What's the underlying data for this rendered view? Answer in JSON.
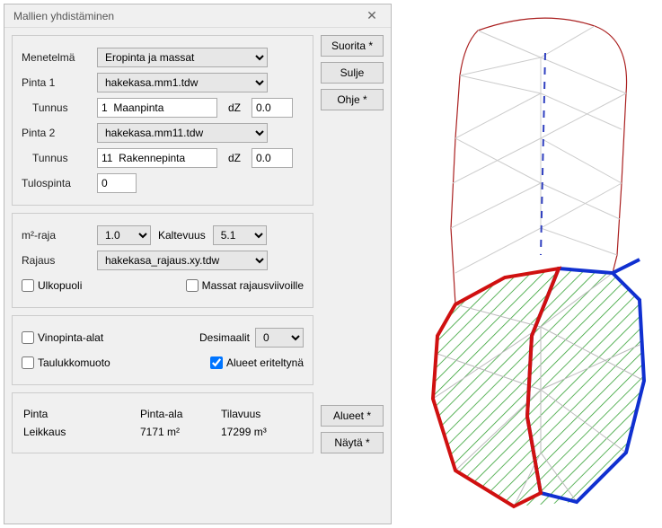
{
  "title": "Mallien yhdistäminen",
  "buttons": {
    "suorita": "Suorita *",
    "sulje": "Sulje",
    "ohje": "Ohje *",
    "alueet": "Alueet *",
    "nayta": "Näytä *"
  },
  "labels": {
    "menetelma": "Menetelmä",
    "pinta1": "Pinta 1",
    "pinta2": "Pinta 2",
    "tunnus": "Tunnus",
    "dz": "dZ",
    "tulospinta": "Tulospinta",
    "m2raja": "m²-raja",
    "kaltevuus": "Kaltevuus",
    "rajaus": "Rajaus",
    "ulkopuoli": "Ulkopuoli",
    "massat_rajaus": "Massat rajausviivoille",
    "vinopinta": "Vinopinta-alat",
    "desimaalit": "Desimaalit",
    "taulukkomuoto": "Taulukkomuoto",
    "alueet_eriteltyna": "Alueet eriteltynä"
  },
  "values": {
    "menetelma": "Eropinta ja massat",
    "pinta1_sel": "hakekasa.mm1.tdw",
    "pinta1_tunnus": "1  Maanpinta",
    "pinta1_dz": "0.0",
    "pinta2_sel": "hakekasa.mm11.tdw",
    "pinta2_tunnus": "11  Rakennepinta",
    "pinta2_dz": "0.0",
    "tulospinta": "0",
    "m2raja": "1.0",
    "kaltevuus": "5.1",
    "rajaus": "hakekasa_rajaus.xy.tdw",
    "desimaalit": "0"
  },
  "results": {
    "headers": {
      "pinta": "Pinta",
      "pintaala": "Pinta-ala",
      "tilavuus": "Tilavuus"
    },
    "rows": [
      {
        "name": "Leikkaus",
        "area": "7171 m²",
        "volume": "17299 m³"
      }
    ]
  }
}
